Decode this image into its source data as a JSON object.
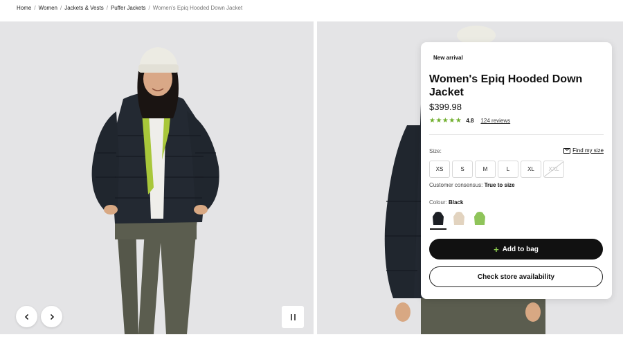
{
  "breadcrumb": {
    "items": [
      "Home",
      "Women",
      "Jackets & Vests",
      "Puffer Jackets"
    ],
    "current": "Women's Epiq Hooded Down Jacket",
    "separator": "/"
  },
  "gallery": {
    "prev_icon": "chevron-left-icon",
    "next_icon": "chevron-right-icon",
    "pause_icon": "pause-icon"
  },
  "product": {
    "badge": "New arrival",
    "title": "Women's Epiq Hooded Down Jacket",
    "price": "$399.98",
    "stars": "★★★★★",
    "rating": "4.8",
    "reviews": "124 reviews",
    "rating_color": "#6fae2c"
  },
  "size": {
    "label": "Size:",
    "find_my_size": "Find my size",
    "options": [
      "XS",
      "S",
      "M",
      "L",
      "XL",
      "XXL"
    ],
    "unavailable": [
      "XXL"
    ],
    "consensus_label": "Customer consensus:",
    "consensus_value": "True to size"
  },
  "colour": {
    "label": "Colour:",
    "selected": "Black",
    "swatch_colors": [
      "#1c1f24",
      "#e2d3bf",
      "#8fc45a"
    ]
  },
  "actions": {
    "add_to_bag": "Add to bag",
    "check_store": "Check store availability"
  }
}
